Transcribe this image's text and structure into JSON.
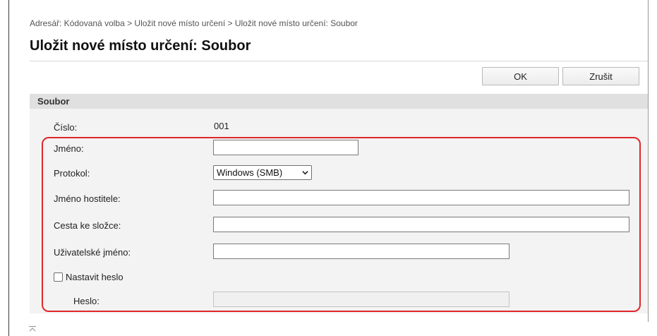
{
  "breadcrumb": "Adresář: Kódovaná volba > Uložit nové místo určení > Uložit nové místo určení: Soubor",
  "page_title": "Uložit nové místo určení: Soubor",
  "buttons": {
    "ok": "OK",
    "cancel": "Zrušit"
  },
  "section": {
    "title": "Soubor",
    "number": {
      "label": "Číslo:",
      "value": "001"
    },
    "name": {
      "label": "Jméno:",
      "value": ""
    },
    "protocol": {
      "label": "Protokol:",
      "selected": "Windows (SMB)"
    },
    "host_name": {
      "label": "Jméno hostitele:",
      "value": ""
    },
    "folder_path": {
      "label": "Cesta ke složce:",
      "value": ""
    },
    "user_name": {
      "label": "Uživatelské jméno:",
      "value": ""
    },
    "set_password": {
      "label": "Nastavit heslo",
      "checked": false
    },
    "password": {
      "label": "Heslo:",
      "value": ""
    }
  },
  "colors": {
    "highlight": "#e0262b",
    "section_header": "#e0e0e0",
    "section_body": "#f3f3f3"
  },
  "icons": {
    "select_arrow": "chevron-down-icon",
    "scroll_top": "back-to-top-icon"
  }
}
